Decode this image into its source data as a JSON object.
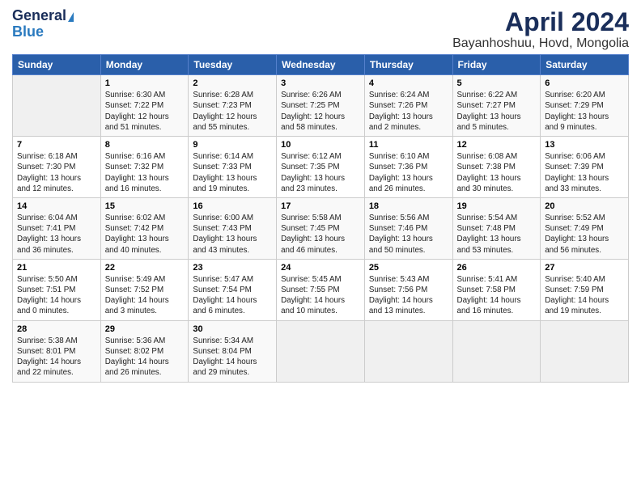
{
  "logo": {
    "general": "General",
    "blue": "Blue"
  },
  "title": {
    "month": "April 2024",
    "location": "Bayanhoshuu, Hovd, Mongolia"
  },
  "headers": [
    "Sunday",
    "Monday",
    "Tuesday",
    "Wednesday",
    "Thursday",
    "Friday",
    "Saturday"
  ],
  "weeks": [
    [
      {
        "num": "",
        "empty": true
      },
      {
        "num": "1",
        "sunrise": "6:30 AM",
        "sunset": "7:22 PM",
        "daylight": "12 hours and 51 minutes."
      },
      {
        "num": "2",
        "sunrise": "6:28 AM",
        "sunset": "7:23 PM",
        "daylight": "12 hours and 55 minutes."
      },
      {
        "num": "3",
        "sunrise": "6:26 AM",
        "sunset": "7:25 PM",
        "daylight": "12 hours and 58 minutes."
      },
      {
        "num": "4",
        "sunrise": "6:24 AM",
        "sunset": "7:26 PM",
        "daylight": "13 hours and 2 minutes."
      },
      {
        "num": "5",
        "sunrise": "6:22 AM",
        "sunset": "7:27 PM",
        "daylight": "13 hours and 5 minutes."
      },
      {
        "num": "6",
        "sunrise": "6:20 AM",
        "sunset": "7:29 PM",
        "daylight": "13 hours and 9 minutes."
      }
    ],
    [
      {
        "num": "7",
        "sunrise": "6:18 AM",
        "sunset": "7:30 PM",
        "daylight": "13 hours and 12 minutes."
      },
      {
        "num": "8",
        "sunrise": "6:16 AM",
        "sunset": "7:32 PM",
        "daylight": "13 hours and 16 minutes."
      },
      {
        "num": "9",
        "sunrise": "6:14 AM",
        "sunset": "7:33 PM",
        "daylight": "13 hours and 19 minutes."
      },
      {
        "num": "10",
        "sunrise": "6:12 AM",
        "sunset": "7:35 PM",
        "daylight": "13 hours and 23 minutes."
      },
      {
        "num": "11",
        "sunrise": "6:10 AM",
        "sunset": "7:36 PM",
        "daylight": "13 hours and 26 minutes."
      },
      {
        "num": "12",
        "sunrise": "6:08 AM",
        "sunset": "7:38 PM",
        "daylight": "13 hours and 30 minutes."
      },
      {
        "num": "13",
        "sunrise": "6:06 AM",
        "sunset": "7:39 PM",
        "daylight": "13 hours and 33 minutes."
      }
    ],
    [
      {
        "num": "14",
        "sunrise": "6:04 AM",
        "sunset": "7:41 PM",
        "daylight": "13 hours and 36 minutes."
      },
      {
        "num": "15",
        "sunrise": "6:02 AM",
        "sunset": "7:42 PM",
        "daylight": "13 hours and 40 minutes."
      },
      {
        "num": "16",
        "sunrise": "6:00 AM",
        "sunset": "7:43 PM",
        "daylight": "13 hours and 43 minutes."
      },
      {
        "num": "17",
        "sunrise": "5:58 AM",
        "sunset": "7:45 PM",
        "daylight": "13 hours and 46 minutes."
      },
      {
        "num": "18",
        "sunrise": "5:56 AM",
        "sunset": "7:46 PM",
        "daylight": "13 hours and 50 minutes."
      },
      {
        "num": "19",
        "sunrise": "5:54 AM",
        "sunset": "7:48 PM",
        "daylight": "13 hours and 53 minutes."
      },
      {
        "num": "20",
        "sunrise": "5:52 AM",
        "sunset": "7:49 PM",
        "daylight": "13 hours and 56 minutes."
      }
    ],
    [
      {
        "num": "21",
        "sunrise": "5:50 AM",
        "sunset": "7:51 PM",
        "daylight": "14 hours and 0 minutes."
      },
      {
        "num": "22",
        "sunrise": "5:49 AM",
        "sunset": "7:52 PM",
        "daylight": "14 hours and 3 minutes."
      },
      {
        "num": "23",
        "sunrise": "5:47 AM",
        "sunset": "7:54 PM",
        "daylight": "14 hours and 6 minutes."
      },
      {
        "num": "24",
        "sunrise": "5:45 AM",
        "sunset": "7:55 PM",
        "daylight": "14 hours and 10 minutes."
      },
      {
        "num": "25",
        "sunrise": "5:43 AM",
        "sunset": "7:56 PM",
        "daylight": "14 hours and 13 minutes."
      },
      {
        "num": "26",
        "sunrise": "5:41 AM",
        "sunset": "7:58 PM",
        "daylight": "14 hours and 16 minutes."
      },
      {
        "num": "27",
        "sunrise": "5:40 AM",
        "sunset": "7:59 PM",
        "daylight": "14 hours and 19 minutes."
      }
    ],
    [
      {
        "num": "28",
        "sunrise": "5:38 AM",
        "sunset": "8:01 PM",
        "daylight": "14 hours and 22 minutes."
      },
      {
        "num": "29",
        "sunrise": "5:36 AM",
        "sunset": "8:02 PM",
        "daylight": "14 hours and 26 minutes."
      },
      {
        "num": "30",
        "sunrise": "5:34 AM",
        "sunset": "8:04 PM",
        "daylight": "14 hours and 29 minutes."
      },
      {
        "num": "",
        "empty": true
      },
      {
        "num": "",
        "empty": true
      },
      {
        "num": "",
        "empty": true
      },
      {
        "num": "",
        "empty": true
      }
    ]
  ]
}
